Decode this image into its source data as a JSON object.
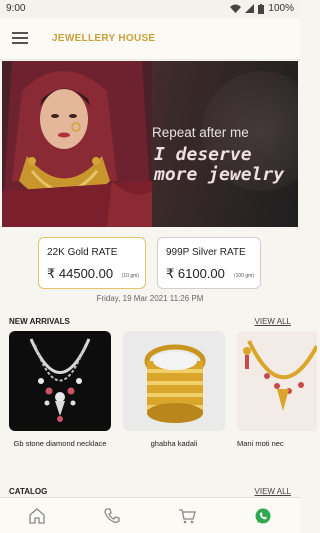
{
  "status_bar": {
    "time": "9:00",
    "battery": "100%"
  },
  "header": {
    "title": "JEWELLERY HOUSE",
    "menu_icon": "hamburger-menu-icon"
  },
  "banner": {
    "line1": "Repeat after me",
    "line2": "I deserve",
    "line3": "more jewelry"
  },
  "rates": {
    "gold": {
      "label": "22K Gold RATE",
      "value": "₹ 44500.00",
      "unit": "(10 gm)"
    },
    "silver": {
      "label": "999P Silver RATE",
      "value": "₹ 6100.00",
      "unit": "(100 gm)"
    },
    "updated": "Friday, 19 Mar 2021 11:26 PM"
  },
  "new_arrivals": {
    "title": "NEW ARRIVALS",
    "view_all": "VIEW ALL",
    "items": [
      {
        "name": "Gb stone diamond necklace"
      },
      {
        "name": "ghabha kadali"
      },
      {
        "name": "Mani moti nec"
      }
    ]
  },
  "catalog": {
    "title": "CATALOG",
    "view_all": "VIEW ALL"
  },
  "bottom_nav": {
    "items": [
      "home-icon",
      "phone-icon",
      "cart-icon",
      "whatsapp-icon"
    ],
    "accent": "#2fa84f"
  },
  "colors": {
    "brand": "#c9a13a",
    "gold_border": "#e6c46a"
  }
}
